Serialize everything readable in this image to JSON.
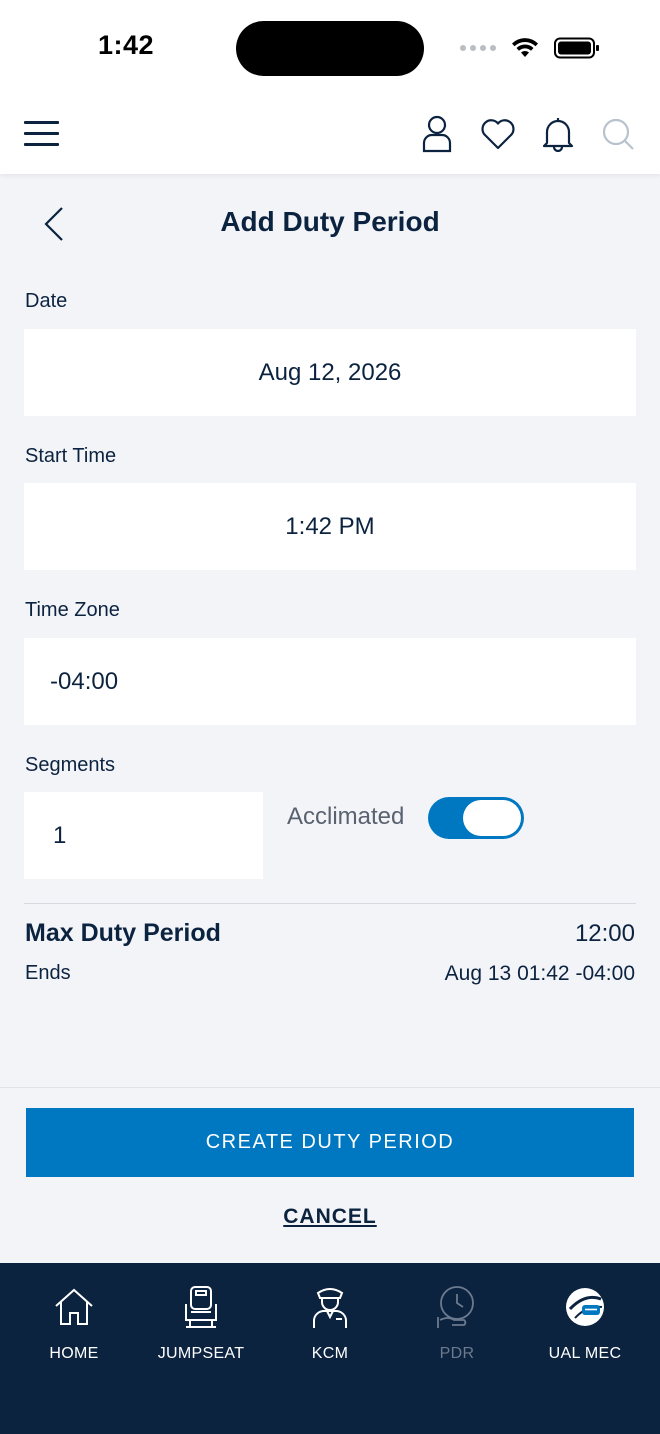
{
  "status_bar": {
    "time": "1:42"
  },
  "header": {
    "icons": [
      "menu-icon",
      "profile-icon",
      "heart-icon",
      "bell-icon",
      "search-icon"
    ]
  },
  "page": {
    "title": "Add Duty Period"
  },
  "form": {
    "date": {
      "label": "Date",
      "value": "Aug 12, 2026"
    },
    "start_time": {
      "label": "Start Time",
      "value": "1:42 PM"
    },
    "time_zone": {
      "label": "Time Zone",
      "value": "-04:00"
    },
    "segments": {
      "label": "Segments",
      "value": "1"
    },
    "acclimated": {
      "label": "Acclimated",
      "on": true
    }
  },
  "summary": {
    "max_duty_label": "Max Duty Period",
    "max_duty_value": "12:00",
    "ends_label": "Ends",
    "ends_value": "Aug 13 01:42 -04:00"
  },
  "actions": {
    "create_label": "CREATE DUTY PERIOD",
    "cancel_label": "CANCEL"
  },
  "tabbar": {
    "items": [
      {
        "label": "HOME",
        "icon": "home-icon"
      },
      {
        "label": "JUMPSEAT",
        "icon": "seat-icon"
      },
      {
        "label": "KCM",
        "icon": "pilot-icon"
      },
      {
        "label": "PDR",
        "icon": "clock-hand-icon",
        "disabled": true
      },
      {
        "label": "UAL MEC",
        "icon": "alpa-globe-icon"
      }
    ]
  },
  "colors": {
    "navy": "#0c2340",
    "accent": "#0078c1",
    "background": "#f2f4f8"
  }
}
